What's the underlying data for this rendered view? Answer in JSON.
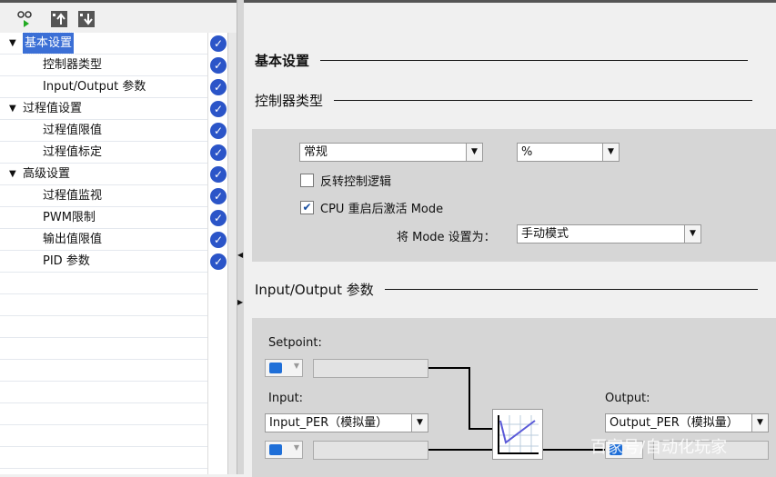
{
  "toolbar": {
    "icons": [
      "glasses-play-icon",
      "move-up-icon",
      "move-down-icon"
    ]
  },
  "tree": {
    "items": [
      {
        "label": "基本设置",
        "level": 0,
        "expanded": true,
        "selected": true
      },
      {
        "label": "控制器类型",
        "level": 1
      },
      {
        "label": "Input/Output 参数",
        "level": 1
      },
      {
        "label": "过程值设置",
        "level": 0,
        "expanded": true
      },
      {
        "label": "过程值限值",
        "level": 1
      },
      {
        "label": "过程值标定",
        "level": 1
      },
      {
        "label": "高级设置",
        "level": 0,
        "expanded": true
      },
      {
        "label": "过程值监视",
        "level": 1
      },
      {
        "label": "PWM限制",
        "level": 1
      },
      {
        "label": "输出值限值",
        "level": 1
      },
      {
        "label": "PID 参数",
        "level": 1
      }
    ]
  },
  "main": {
    "section_title": "基本设置",
    "controller_type": {
      "title": "控制器类型",
      "type_value": "常规",
      "unit_value": "%",
      "invert_label": "反转控制逻辑",
      "invert_checked": false,
      "cpu_restart_label": "CPU 重启后激活 Mode",
      "cpu_restart_checked": true,
      "mode_label": "将 Mode 设置为：",
      "mode_value": "手动模式"
    },
    "io": {
      "title": "Input/Output 参数",
      "setpoint_label": "Setpoint:",
      "input_label": "Input:",
      "input_value": "Input_PER（模拟量）",
      "output_label": "Output:",
      "output_value": "Output_PER（模拟量）"
    }
  },
  "watermark": "百家号/自动化玩家"
}
